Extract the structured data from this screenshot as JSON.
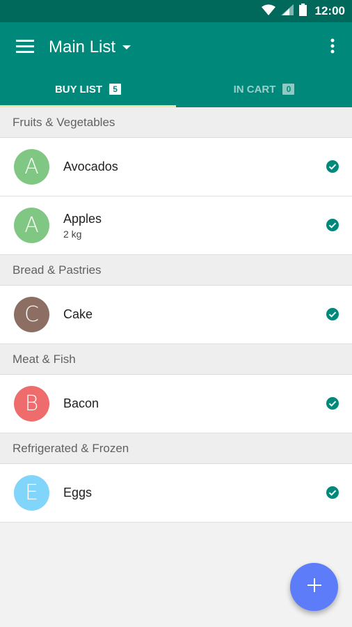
{
  "status_bar": {
    "time": "12:00",
    "icons": [
      "wifi-icon",
      "signal-icon",
      "battery-icon"
    ]
  },
  "app_bar": {
    "title": "Main List",
    "icons": [
      "menu-icon",
      "dropdown-arrow-icon",
      "overflow-menu-icon"
    ],
    "color": "#00897b"
  },
  "tabs": [
    {
      "label": "BUY LIST",
      "count": "5",
      "active": true
    },
    {
      "label": "IN CART",
      "count": "0",
      "active": false
    }
  ],
  "sections": [
    {
      "title": "Fruits & Vegetables",
      "items": [
        {
          "letter": "A",
          "name": "Avocados",
          "qty": "",
          "color": "#81c784"
        },
        {
          "letter": "A",
          "name": "Apples",
          "qty": "2 kg",
          "color": "#81c784"
        }
      ]
    },
    {
      "title": "Bread & Pastries",
      "items": [
        {
          "letter": "C",
          "name": "Cake",
          "qty": "",
          "color": "#8d6e63"
        }
      ]
    },
    {
      "title": "Meat & Fish",
      "items": [
        {
          "letter": "B",
          "name": "Bacon",
          "qty": "",
          "color": "#ef6c6c"
        }
      ]
    },
    {
      "title": "Refrigerated & Frozen",
      "items": [
        {
          "letter": "E",
          "name": "Eggs",
          "qty": "",
          "color": "#81d4fa"
        }
      ]
    }
  ],
  "check_icon": "check-circle-icon",
  "check_color": "#00897b",
  "fab": {
    "icon": "plus-icon",
    "color": "#5c7cfa"
  }
}
